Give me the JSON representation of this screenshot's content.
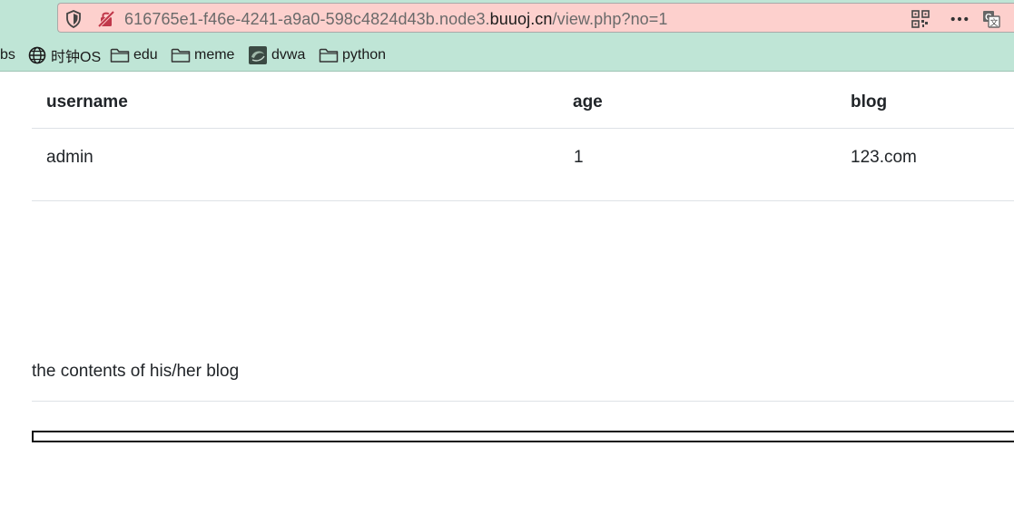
{
  "browser": {
    "url_prefix": "616765e1-f46e-4241-a9a0-598c4824d43b.node3.",
    "url_domain": "buuoj.cn",
    "url_path": "/view.php?no=1",
    "icons": {
      "shield": "shield-icon",
      "insecure": "insecure-lock-icon",
      "qr": "qr-code-icon",
      "menu": "more-options-icon",
      "translate": "translate-icon"
    }
  },
  "bookmarks": [
    {
      "label": "bs",
      "icon": "none"
    },
    {
      "label": "时钟OS",
      "icon": "globe-icon"
    },
    {
      "label": "edu",
      "icon": "folder-icon"
    },
    {
      "label": "meme",
      "icon": "folder-icon"
    },
    {
      "label": "dvwa",
      "icon": "site-icon"
    },
    {
      "label": "python",
      "icon": "folder-icon"
    }
  ],
  "table": {
    "headers": [
      "username",
      "age",
      "blog"
    ],
    "rows": [
      [
        "admin",
        "1",
        "123.com"
      ]
    ]
  },
  "blog_heading": "the contents of his/her blog",
  "colors": {
    "chrome": "#bfe5d6",
    "urlbar": "#fdd0cd",
    "text": "#212529",
    "divider": "#dee2e6"
  }
}
